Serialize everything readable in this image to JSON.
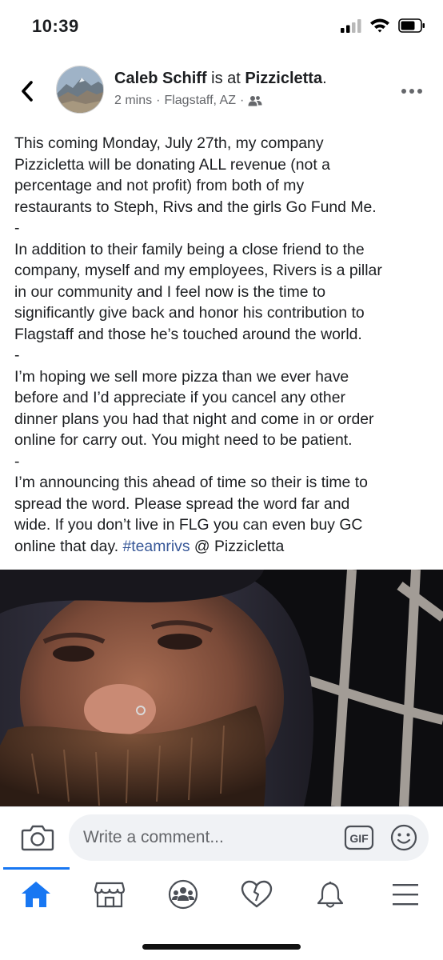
{
  "status_bar": {
    "time": "10:39"
  },
  "post": {
    "author": "Caleb Schiff",
    "connector": " is at ",
    "place": "Pizzicletta",
    "place_suffix": ".",
    "time_ago": "2 mins",
    "separator": "·",
    "location": "Flagstaff, AZ",
    "privacy_icon": "friends-icon",
    "paragraphs": [
      "This coming Monday, July 27th, my company\nPizzicletta will be donating ALL revenue (not a\npercentage and not profit) from both of my\nrestaurants to Steph, Rivs and the girls Go Fund Me.\n-",
      "In addition to their family being a close friend to the\ncompany, myself and my employees, Rivers is a pillar\nin our community and I feel now is the time to\nsignificantly give back and honor his contribution to\nFlagstaff and those he’s touched around the world.\n-",
      "I’m hoping we sell more pizza than we ever have\nbefore and I’d appreciate if you cancel any other\ndinner plans you had that night and come in or order\nonline for carry out. You might need to be patient.\n-",
      "I’m announcing this ahead of time so their is time to\nspread the word. Please spread the word far and\nwide. If you don’t live in FLG you can even buy GC\nonline that day. "
    ],
    "hashtag": "#teamrivs",
    "tail": " @ Pizzicletta"
  },
  "comment_bar": {
    "placeholder": "Write a comment...",
    "gif_label": "GIF"
  },
  "tab_bar": {
    "tabs": [
      "home-icon",
      "marketplace-icon",
      "groups-icon",
      "dating-icon",
      "notifications-icon",
      "menu-icon"
    ],
    "active": "home-icon"
  },
  "colors": {
    "accent": "#1877f2",
    "hashtag": "#385898",
    "secondary_text": "#65676b",
    "input_background": "#f0f2f5"
  }
}
